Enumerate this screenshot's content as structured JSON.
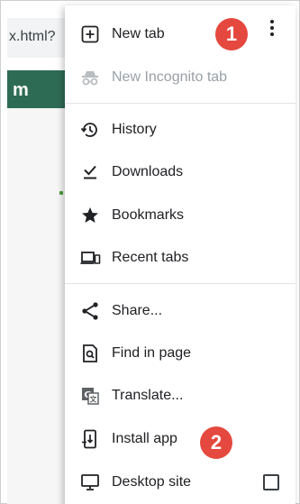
{
  "background_page": {
    "url_text": "x.html?",
    "header_text": "m"
  },
  "menu": {
    "items": [
      {
        "label": "New tab",
        "icon": "plus-box-icon",
        "enabled": true
      },
      {
        "label": "New Incognito tab",
        "icon": "incognito-icon",
        "enabled": false
      },
      {
        "label": "History",
        "icon": "history-icon",
        "enabled": true
      },
      {
        "label": "Downloads",
        "icon": "download-icon",
        "enabled": true
      },
      {
        "label": "Bookmarks",
        "icon": "star-icon",
        "enabled": true
      },
      {
        "label": "Recent tabs",
        "icon": "devices-icon",
        "enabled": true
      },
      {
        "label": "Share...",
        "icon": "share-icon",
        "enabled": true
      },
      {
        "label": "Find in page",
        "icon": "find-in-page-icon",
        "enabled": true
      },
      {
        "label": "Translate...",
        "icon": "translate-icon",
        "enabled": true
      },
      {
        "label": "Install app",
        "icon": "install-app-icon",
        "enabled": true
      },
      {
        "label": "Desktop site",
        "icon": "desktop-icon",
        "enabled": true
      }
    ],
    "desktop_site_checked": false
  },
  "callouts": [
    {
      "label": "1"
    },
    {
      "label": "2"
    }
  ],
  "colors": {
    "callout": "#e5483e",
    "page_header": "#2e6b55",
    "disabled_text": "#9aa0a6"
  }
}
